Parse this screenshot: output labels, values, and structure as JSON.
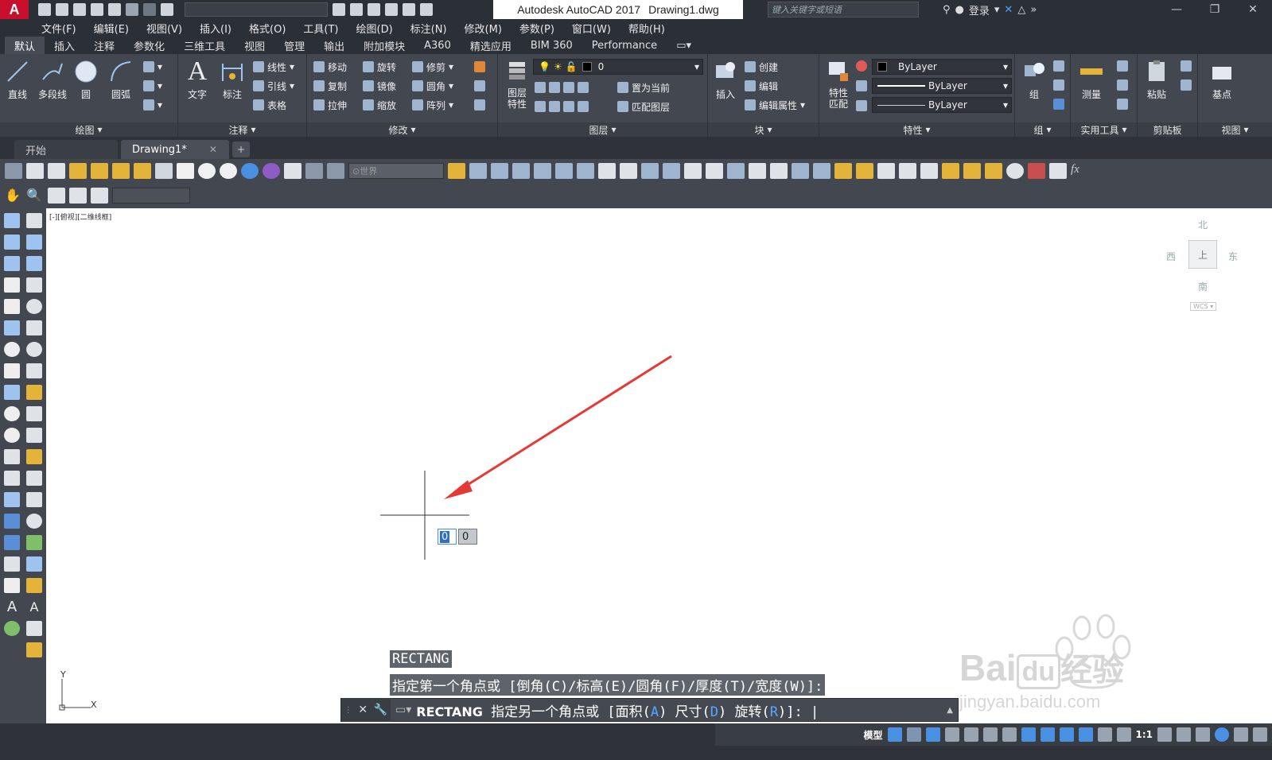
{
  "app": {
    "logo_text": "A",
    "title": "Autodesk AutoCAD 2017",
    "document": "Drawing1.dwg",
    "search_placeholder": "键入关键字或短语",
    "login_label": "登录",
    "workspace_value": "",
    "colors": {
      "title_bg": "#2b2f36",
      "ribbon_bg": "#434850",
      "accent_red": "#c8102e",
      "option_blue": "#56a9ff",
      "arrow_red": "#e53935"
    }
  },
  "menubar": [
    "文件(F)",
    "编辑(E)",
    "视图(V)",
    "插入(I)",
    "格式(O)",
    "工具(T)",
    "绘图(D)",
    "标注(N)",
    "修改(M)",
    "参数(P)",
    "窗口(W)",
    "帮助(H)"
  ],
  "ribbon_tabs": [
    "默认",
    "插入",
    "注释",
    "参数化",
    "三维工具",
    "视图",
    "管理",
    "输出",
    "附加模块",
    "A360",
    "精选应用",
    "BIM 360",
    "Performance"
  ],
  "ribbon": {
    "draw": {
      "title": "绘图",
      "tools": [
        "直线",
        "多段线",
        "圆",
        "圆弧"
      ]
    },
    "annotation": {
      "title": "注释",
      "big": [
        "文字",
        "标注"
      ],
      "small": [
        "线性",
        "引线",
        "表格"
      ]
    },
    "modify": {
      "title": "修改",
      "small": [
        "移动",
        "旋转",
        "修剪",
        "复制",
        "镜像",
        "圆角",
        "拉伸",
        "缩放",
        "阵列"
      ]
    },
    "layers": {
      "title": "图层",
      "big": "图层\n特性",
      "layer_value": "0",
      "small": [
        "置为当前",
        "匹配图层"
      ]
    },
    "block": {
      "title": "块",
      "big": "插入",
      "small": [
        "创建",
        "编辑",
        "编辑属性"
      ]
    },
    "properties": {
      "title": "特性",
      "big": "特性\n匹配",
      "color": "ByLayer",
      "linetype": "ByLayer",
      "lineweight": "ByLayer"
    },
    "group": {
      "title": "组",
      "big": "组"
    },
    "utilities": {
      "title": "实用工具",
      "big": "测量"
    },
    "clipboard": {
      "title": "剪贴板",
      "big": "粘贴"
    },
    "view": {
      "title": "视图",
      "big": "基点"
    }
  },
  "file_tabs": [
    {
      "label": "开始"
    },
    {
      "label": "Drawing1*"
    }
  ],
  "toolbar": {
    "ucs_combo": "世界"
  },
  "viewport": {
    "label": "[-][俯视][二维线框]"
  },
  "viewcube": {
    "north": "北",
    "south": "南",
    "east": "东",
    "west": "西",
    "top": "上",
    "wcs": "WCS"
  },
  "ucs_icon": {
    "x": "X",
    "y": "Y"
  },
  "dynamic_input": {
    "x_value": "0",
    "y_value": "0"
  },
  "command": {
    "history": [
      "RECTANG",
      "指定第一个角点或 [倒角(C)/标高(E)/圆角(F)/厚度(T)/宽度(W)]:"
    ],
    "current_name": "RECTANG",
    "prompt_pre": "指定另一个角点或 [面积(",
    "opt1": "A",
    "mid1": ") 尺寸(",
    "opt2": "D",
    "mid2": ") 旋转(",
    "opt3": "R",
    "prompt_post": ")]:"
  },
  "statusbar": {
    "model_label": "模型",
    "scale": "1:1"
  },
  "watermark": {
    "brand_a": "Bai",
    "brand_b": "du",
    "brand_c": "经验",
    "url": "jingyan.baidu.com"
  }
}
